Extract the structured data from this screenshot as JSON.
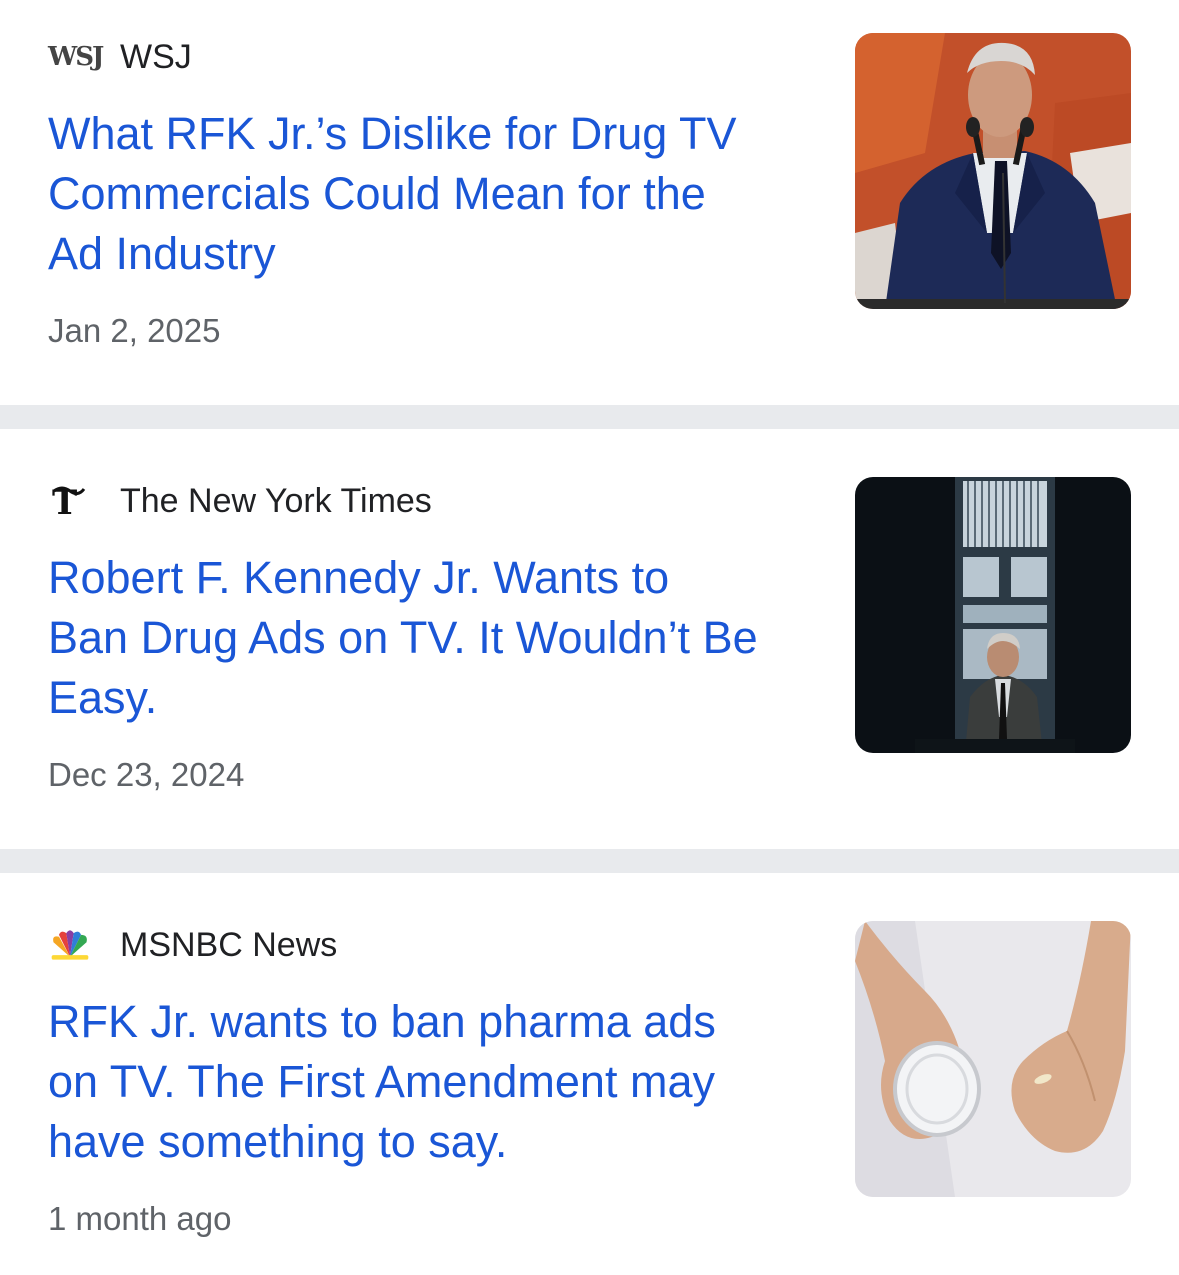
{
  "articles": [
    {
      "source": "WSJ",
      "source_logo_icon": "wsj-logo-icon",
      "source_logo_text": "WSJ",
      "headline_lines": [
        "What RFK Jr.’s Dislike for Drug TV",
        "Commercials Could Mean for the",
        "Ad Industry"
      ],
      "date": "Jan 2, 2025",
      "thumbnail_icon": "rfk-speaking-at-podium-photo"
    },
    {
      "source": "The New York Times",
      "source_logo_icon": "nyt-logo-icon",
      "source_logo_text": "𝕿",
      "headline_lines": [
        "Robert F. Kennedy Jr. Wants to",
        "Ban Drug Ads on TV. It Wouldn’t Be",
        "Easy."
      ],
      "date": "Dec 23, 2024",
      "thumbnail_icon": "rfk-by-window-photo"
    },
    {
      "source": "MSNBC News",
      "source_logo_icon": "nbc-peacock-logo-icon",
      "headline_lines": [
        "RFK Jr. wants to ban pharma ads",
        "on TV. The First Amendment may",
        "have something to say."
      ],
      "date": "1 month ago",
      "thumbnail_icon": "hands-holding-glass-and-pill-photo"
    }
  ],
  "colors": {
    "headline": "#1a56d6",
    "source_text": "#202124",
    "date_text": "#5f6368",
    "divider": "#e8eaed",
    "background": "#ffffff"
  }
}
